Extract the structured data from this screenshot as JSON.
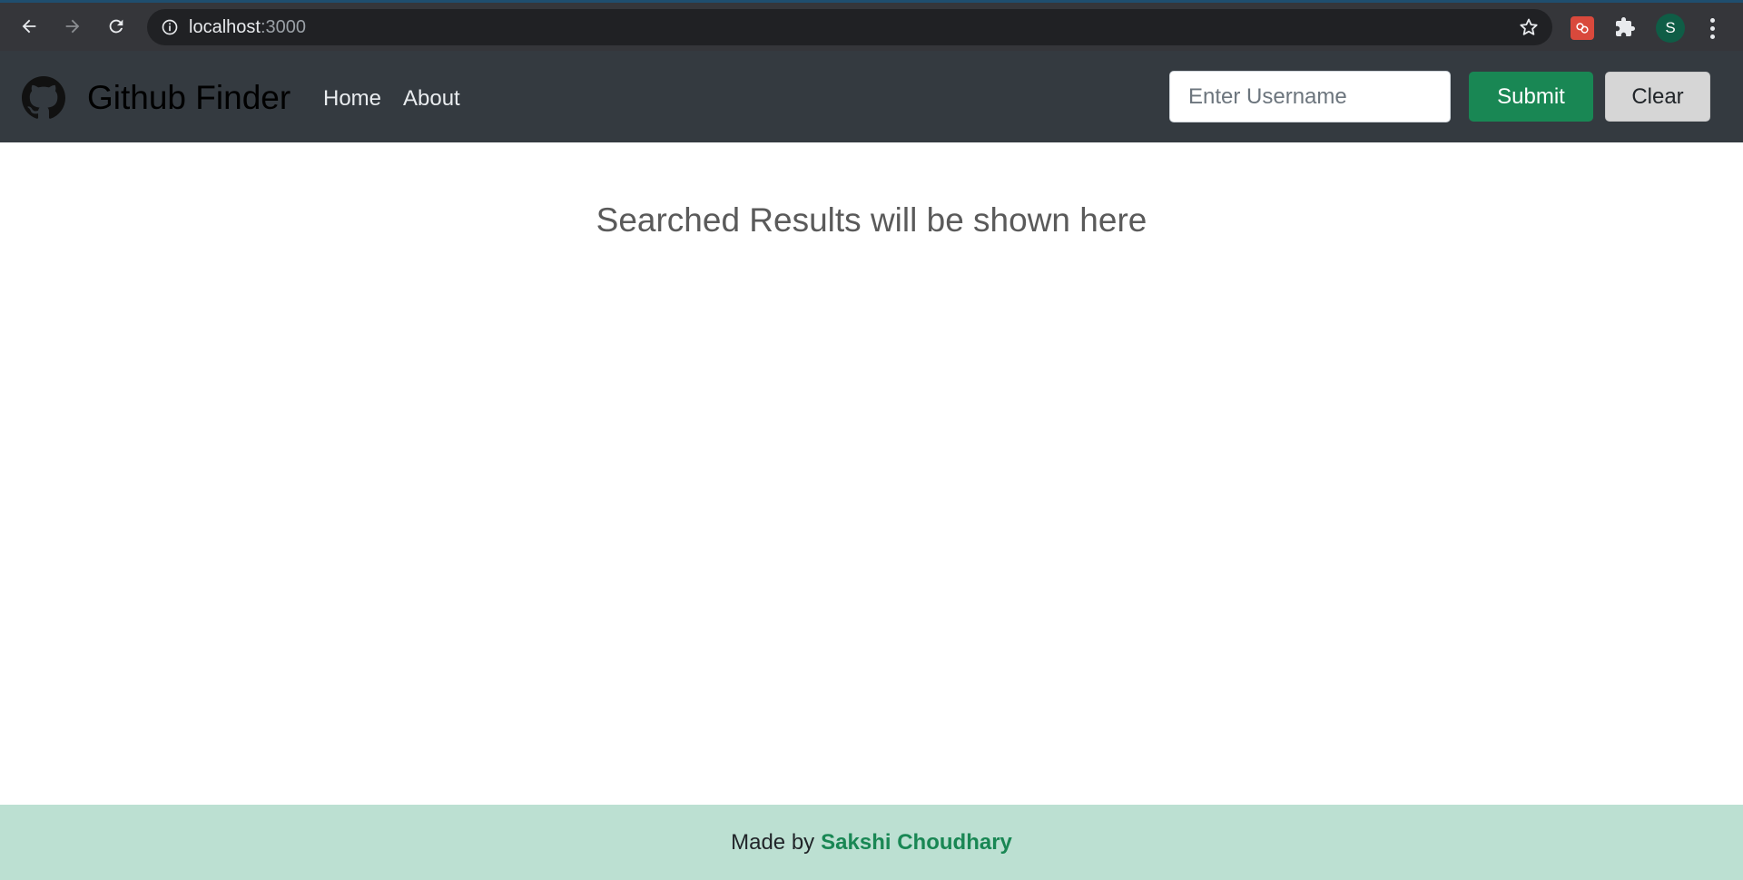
{
  "browser": {
    "url_host": "localhost",
    "url_port": ":3000",
    "profile_initial": "S",
    "icons": {
      "back": "arrow-left-icon",
      "forward": "arrow-right-icon",
      "reload": "reload-icon",
      "site_info": "info-icon",
      "bookmark": "star-icon",
      "extension_1": "red-extension-icon",
      "extensions": "puzzle-icon",
      "menu": "kebab-menu-icon"
    }
  },
  "navbar": {
    "brand_title": "Github Finder",
    "brand_icon": "github-icon",
    "links": [
      "Home",
      "About"
    ],
    "search_placeholder": "Enter Username",
    "search_value": "",
    "submit_label": "Submit",
    "clear_label": "Clear"
  },
  "main": {
    "message": "Searched Results will be shown here"
  },
  "footer": {
    "prefix": "Made by",
    "author": "Sakshi Choudhary"
  },
  "colors": {
    "navbar_bg": "#343a40",
    "submit_bg": "#198754",
    "clear_bg": "#d6d6d6",
    "footer_bg": "#bce0d2",
    "author_color": "#198754"
  }
}
